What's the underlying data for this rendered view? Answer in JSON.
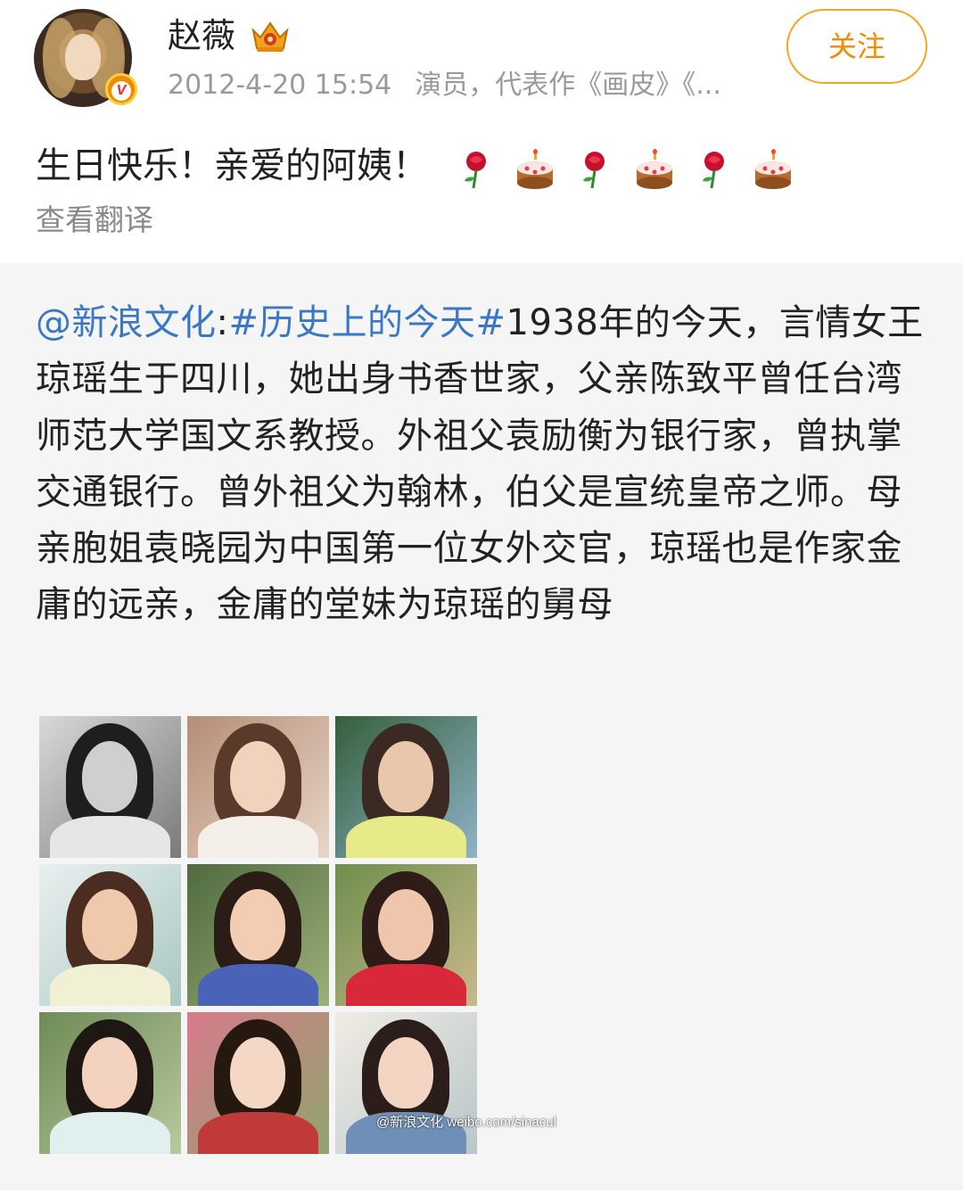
{
  "post": {
    "author": "赵薇",
    "timestamp": "2012-4-20 15:54",
    "author_description": "演员，代表作《画皮》《...",
    "follow_label": "关注",
    "text": "生日快乐！亲爱的阿姨！",
    "emojis": [
      "rose-icon",
      "cake-icon",
      "rose-icon",
      "cake-icon",
      "rose-icon",
      "cake-icon"
    ],
    "translate_label": "查看翻译"
  },
  "repost": {
    "mention": "@新浪文化",
    "colon": ":",
    "topic": "#历史上的今天#",
    "body": "1938年的今天，言情女王琼瑶生于四川，她出身书香世家，父亲陈致平曾任台湾师范大学国文系教授。外祖父袁励衡为银行家，曾执掌交通银行。曾外祖父为翰林，伯父是宣统皇帝之师。母亲胞姐袁晓园为中国第一位女外交官，琼瑶也是作家金庸的远亲，金庸的堂妹为琼瑶的舅母",
    "image_count": 9,
    "watermark": "@新浪文化 weibo.com/sinacul"
  },
  "colors": {
    "accent_link": "#3b78c4",
    "follow_orange": "#f08c00",
    "repost_bg": "#f5f5f5"
  }
}
